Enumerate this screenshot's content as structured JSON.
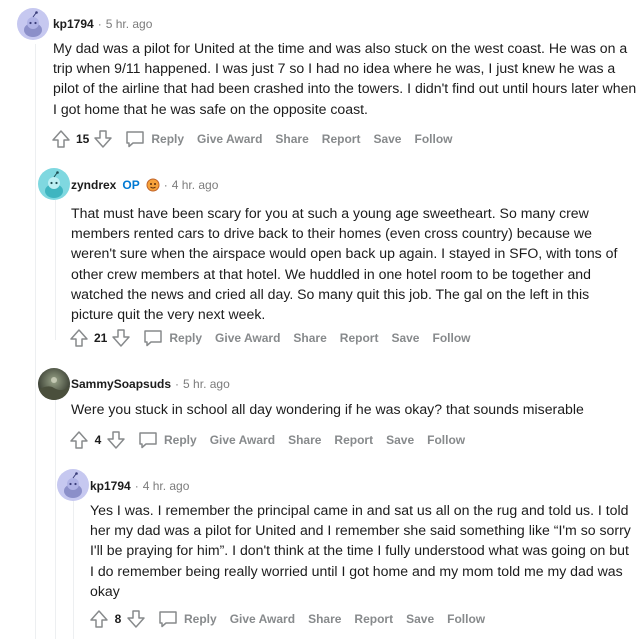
{
  "comments": [
    {
      "author": "kp1794",
      "op": "",
      "time": "5 hr. ago",
      "body": "My dad was a pilot for United at the time and was also stuck on the west coast. He was on a trip when 9/11 happened. I was just 7 so I had no idea where he was, I just knew he was a pilot of the airline that had been crashed into the towers. I didn't find out until hours later when I got home that he was safe on the opposite coast.",
      "score": "15",
      "avatar": "snoo-avatar-lavender"
    },
    {
      "author": "zyndrex",
      "op": "OP",
      "time": "4 hr. ago",
      "body": "That must have been scary for you at such a young age sweetheart. So many crew members rented cars to drive back to their homes (even cross country) because we weren't sure when the airspace would open back up again. I stayed in SFO, with tons of other crew members at that hotel. We huddled in one hotel room to be together and watched the news and cried all day. So many quit this job. The gal on the left in this picture quit the very next week.",
      "score": "21",
      "avatar": "snoo-avatar-teal"
    },
    {
      "author": "SammySoapsuds",
      "op": "",
      "time": "5 hr. ago",
      "body": "Were you stuck in school all day wondering if he was okay? that sounds miserable",
      "score": "4",
      "avatar": "photo-avatar"
    },
    {
      "author": "kp1794",
      "op": "",
      "time": "4 hr. ago",
      "body": "Yes I was. I remember the principal came in and sat us all on the rug and told us. I told her my dad was a pilot for United and I remember she said something like “I'm so sorry I'll be praying for him”. I don't think at the time I fully understood what was going on but I do remember being really worried until I got home and my mom told me my dad was okay",
      "score": "8",
      "avatar": "snoo-avatar-lavender"
    }
  ],
  "actions": {
    "reply": "Reply",
    "give_award": "Give Award",
    "share": "Share",
    "report": "Report",
    "save": "Save",
    "follow": "Follow"
  },
  "separator": "·",
  "colors": {
    "meta_gray": "#7c7c7c",
    "action_gray": "#878a8c",
    "op_blue": "#0079d3",
    "avatar_lavender": "#c6c8f0",
    "avatar_teal": "#7fd8e0"
  }
}
